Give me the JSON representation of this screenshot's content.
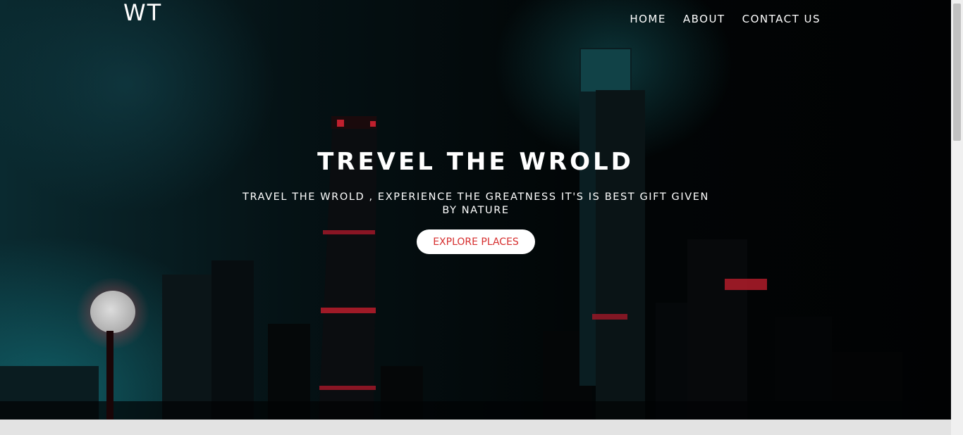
{
  "header": {
    "logo": "WT",
    "nav": [
      {
        "label": "HOME"
      },
      {
        "label": "ABOUT"
      },
      {
        "label": "CONTACT US"
      }
    ]
  },
  "hero": {
    "title": "TREVEL THE WROLD",
    "subtitle": "TRAVEL THE WROLD , EXPERIENCE THE GREATNESS IT'S IS BEST GIFT GIVEN BY NATURE",
    "cta_label": "EXPLORE PLACES",
    "cta_text_color": "#d62e2e",
    "background_image": "night city skyline with neon lit skyscrapers and a glowing street lamp"
  }
}
